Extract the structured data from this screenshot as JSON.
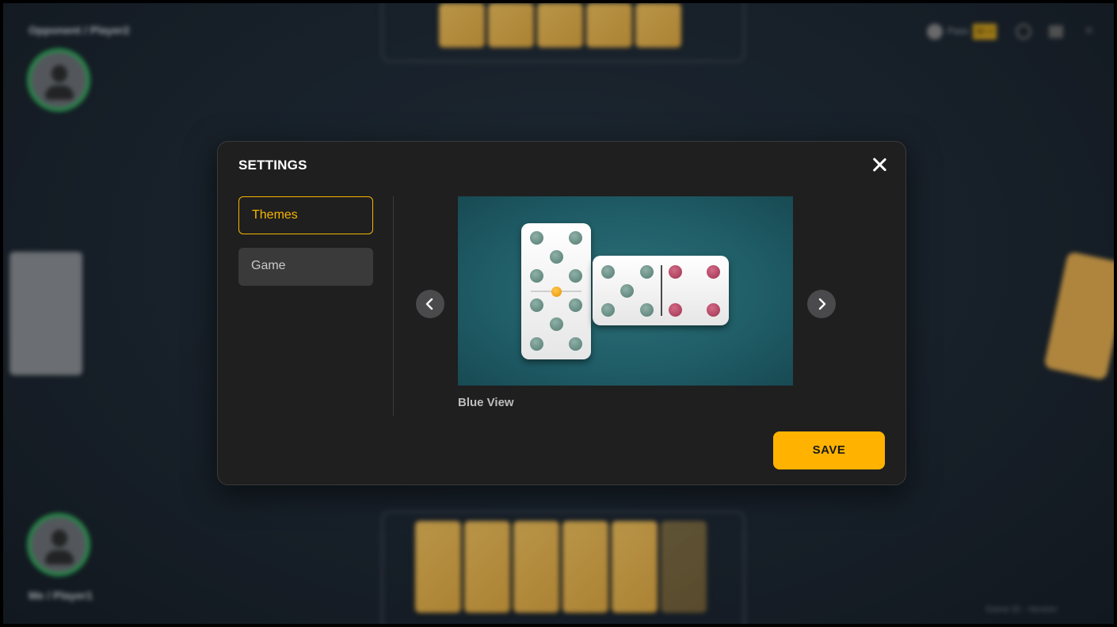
{
  "background": {
    "opponent_label": "Opponent / Player2",
    "me_label": "Me / Player1",
    "toolbar": {
      "balance_label": "Pass",
      "balance_value": "$0.0",
      "icons": [
        "coin-icon",
        "gear-icon",
        "mute-icon",
        "close-icon"
      ]
    },
    "footer_text": "Game ID - Version"
  },
  "modal": {
    "title": "SETTINGS",
    "menu": [
      {
        "label": "Themes",
        "active": true
      },
      {
        "label": "Game",
        "active": false
      }
    ],
    "preview": {
      "caption": "Blue View",
      "theme_color": "#1f5c66"
    },
    "prev_icon": "chevron-left-icon",
    "next_icon": "chevron-right-icon",
    "close_icon": "close-icon",
    "save_label": "SAVE"
  },
  "colors": {
    "accent": "#ffb300",
    "player_ring": "#2fb25a",
    "pip_green": "#5d8279",
    "pip_red": "#b23f5e",
    "pip_orange": "#f5a30a"
  }
}
